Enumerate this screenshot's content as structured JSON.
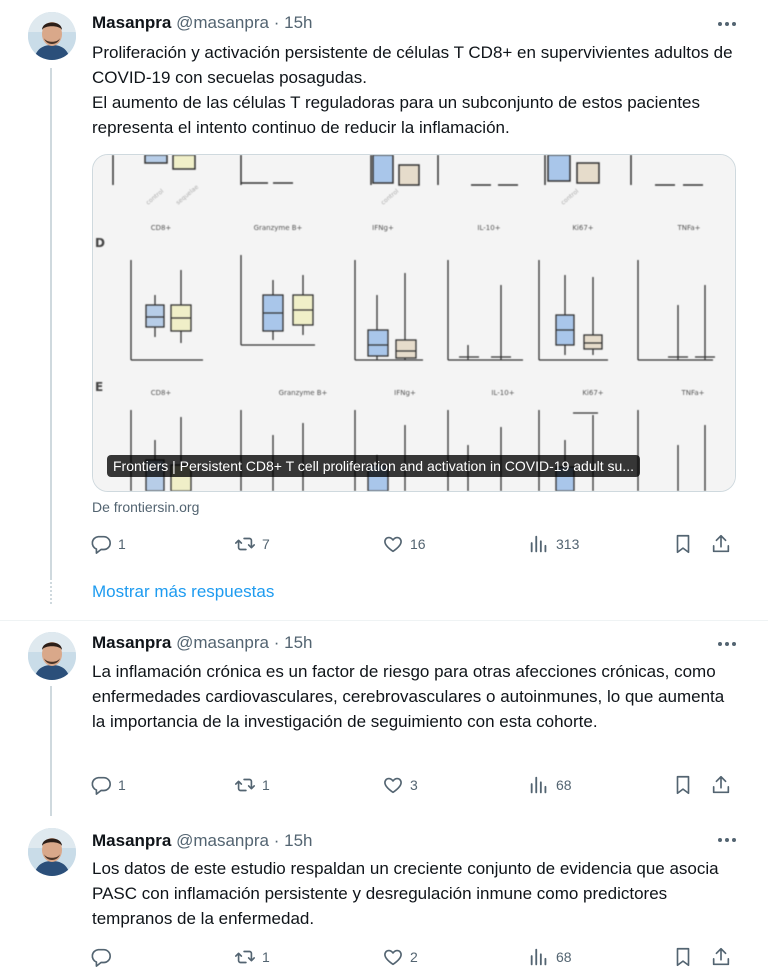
{
  "tweets": [
    {
      "name": "Masanpra",
      "handle": "@masanpra",
      "separator": "·",
      "time": "15h",
      "paragraphs": [
        "Proliferación y activación persistente de células T CD8+ en supervivientes adultos de COVID-19 con secuelas posagudas.",
        "El aumento de las células T reguladoras para un subconjunto de estos pacientes representa el intento continuo de reducir la inflamación."
      ],
      "card": {
        "caption": "Frontiers | Persistent CD8+ T cell proliferation and activation in COVID-19 adult su...",
        "source": "De frontiersin.org",
        "panel_letters": [
          "D",
          "E"
        ],
        "panel_row1_titles": [
          "CD8+",
          "Granzyme B+",
          "IFNg+",
          "IL-10+",
          "Ki67+",
          "TNFa+"
        ],
        "panel_row2_titles": [
          "CD8+",
          "Granzyme B+",
          "IFNg+",
          "IL-10+",
          "Ki67+",
          "TNFa+"
        ]
      },
      "stats": {
        "replies": "1",
        "reposts": "7",
        "likes": "16",
        "views": "313"
      }
    },
    {
      "name": "Masanpra",
      "handle": "@masanpra",
      "separator": "·",
      "time": "15h",
      "paragraphs": [
        "La inflamación crónica es un factor de riesgo para otras afecciones crónicas, como enfermedades cardiovasculares, cerebrovasculares o autoinmunes, lo que aumenta la importancia de la investigación de seguimiento con esta cohorte."
      ],
      "stats": {
        "replies": "1",
        "reposts": "1",
        "likes": "3",
        "views": "68"
      }
    },
    {
      "name": "Masanpra",
      "handle": "@masanpra",
      "separator": "·",
      "time": "15h",
      "paragraphs": [
        "Los datos de este estudio respaldan un creciente conjunto de evidencia que asocia PASC con inflamación persistente y desregulación inmune como predictores tempranos de la enfermedad."
      ],
      "stats": {
        "replies": "",
        "reposts": "1",
        "likes": "2",
        "views": "68"
      }
    }
  ],
  "show_more": "Mostrar más respuestas",
  "colors": {
    "accent": "#1d9bf0",
    "muted": "#536471",
    "text": "#0f1419",
    "divider": "#cfd9de"
  },
  "icons": [
    "reply-icon",
    "repost-icon",
    "like-icon",
    "views-icon",
    "bookmark-icon",
    "share-icon",
    "more-icon"
  ]
}
